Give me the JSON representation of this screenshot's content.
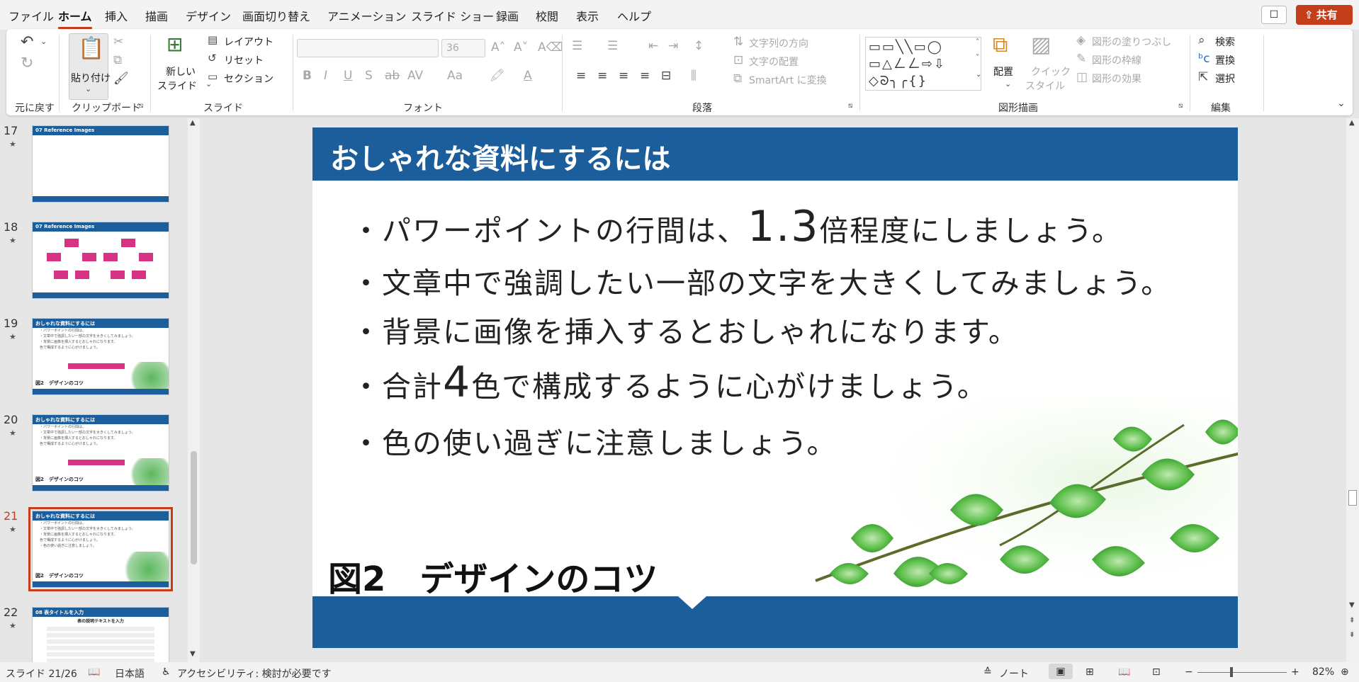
{
  "menu": [
    "ファイル",
    "ホーム",
    "挿入",
    "描画",
    "デザイン",
    "画面切り替え",
    "アニメーション",
    "スライド ショー",
    "録画",
    "校閲",
    "表示",
    "ヘルプ"
  ],
  "share_label": "共有",
  "ribbon": {
    "groups": {
      "undo": "元に戻す",
      "clipboard": "クリップボード",
      "slides": "スライド",
      "font": "フォント",
      "paragraph": "段落",
      "drawing": "図形描画",
      "editing": "編集"
    },
    "paste_label": "貼り付け",
    "new_slide": [
      "新しい",
      "スライド"
    ],
    "layout": "レイアウト",
    "reset": "リセット",
    "section": "セクション",
    "font_size": "36",
    "text_direction": "文字列の方向",
    "text_align": "文字の配置",
    "smartart": "SmartArt に変換",
    "arrange": "配置",
    "quick_style": [
      "クイック",
      "スタイル"
    ],
    "shape_fill": "図形の塗りつぶし",
    "shape_outline": "図形の枠線",
    "shape_effects": "図形の効果",
    "find": "検索",
    "replace": "置換",
    "select": "選択"
  },
  "thumbnails": [
    {
      "num": "17",
      "title": "07 Reference Images",
      "page": "17"
    },
    {
      "num": "18",
      "title": "07 Reference Images",
      "page": "18"
    },
    {
      "num": "19",
      "title": "おしゃれな資料にするには"
    },
    {
      "num": "20",
      "title": "おしゃれな資料にするには"
    },
    {
      "num": "21",
      "title": "おしゃれな資料にするには",
      "selected": true
    },
    {
      "num": "22",
      "title": "08 表タイトルを入力",
      "page": "22",
      "subtitle": "表の説明テキストを入力"
    }
  ],
  "thumb_caption": "図2　デザインのコツ",
  "slide": {
    "title": "おしゃれな資料にするには",
    "bullets": [
      {
        "pre": "・パワーポイントの行間は、",
        "big": "1.3",
        "post": "倍程度にしましょう。"
      },
      {
        "pre": "・文章中で強調したい一部の文字を大きくしてみましょう。",
        "big": "",
        "post": ""
      },
      {
        "pre": "・背景に画像を挿入するとおしゃれになります。",
        "big": "",
        "post": ""
      },
      {
        "pre": "・合計",
        "big": "4",
        "post": "色で構成するように心がけましょう。"
      },
      {
        "pre": "・色の使い過ぎに注意しましょう。",
        "big": "",
        "post": ""
      }
    ],
    "caption": "図2　デザインのコツ"
  },
  "status": {
    "slide_pos": "スライド 21/26",
    "language": "日本語",
    "accessibility": "アクセシビリティ: 検討が必要です",
    "notes": "ノート",
    "zoom": "82%"
  },
  "colors": {
    "brand": "#c43e1c",
    "slide_blue": "#1c5e9c",
    "leaf": "#4caf50"
  }
}
